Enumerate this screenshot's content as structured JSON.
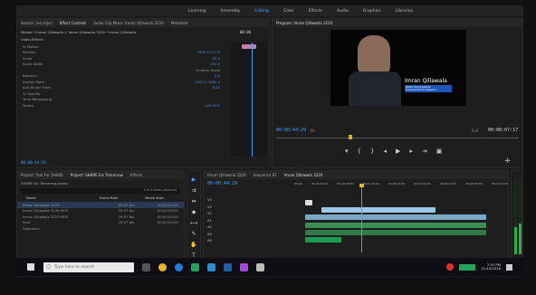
{
  "workspace_tabs": [
    "Learning",
    "Assembly",
    "Editing",
    "Color",
    "Effects",
    "Audio",
    "Graphics",
    "Libraries"
  ],
  "source_panel": {
    "tabs": [
      "Source: (no clips)",
      "Effect Controls",
      "Audio Clip Mixer: Imran Qillawala 3220",
      "Metadata"
    ],
    "clip_path": "Master * Imran Qillawala  >  Imran Qillawala 3220 * Imran Qillawala",
    "section": "Video Effects",
    "rows": [
      {
        "label": "fx  Motion",
        "value": ""
      },
      {
        "label": "Position",
        "value": "1920.0   571.0"
      },
      {
        "label": "Scale",
        "value": "93.0"
      },
      {
        "label": "Scale Width",
        "value": "100.0"
      },
      {
        "label": "",
        "value": "Uniform Scale"
      },
      {
        "label": "Rotation",
        "value": "0.0"
      },
      {
        "label": "Anchor Point",
        "value": "1920.0   1080.0"
      },
      {
        "label": "Anti-flicker Filter",
        "value": "0.00"
      },
      {
        "label": "fx  Opacity",
        "value": ""
      },
      {
        "label": "Time Remapping",
        "value": ""
      },
      {
        "label": "Speed",
        "value": "100.00%"
      }
    ],
    "timecode_head": "00:00",
    "timecode": "00:00:44:29"
  },
  "program": {
    "title": "Program: Imran Qillawala 3220",
    "name": "Imran Qillawala",
    "subtitle1": "Global Vice President",
    "subtitle2": "Divisional Home Inspector",
    "timecode": "00:00:44:29",
    "fit": "Fit",
    "res": "Full",
    "duration": "00:08:07:17"
  },
  "project": {
    "tabs": [
      "Project: Text For SHARE",
      "Project: SHARE For Tomorrow",
      "Effects"
    ],
    "file": "SHARE For Tomorrow.prproj",
    "selection": "1 of 4 items selected",
    "cols": [
      "Name",
      "Frame Rate",
      "Media Start"
    ],
    "items": [
      {
        "name": "Imran Qillawala 3220",
        "rate": "29.97 fps",
        "start": "00;00;00;00"
      },
      {
        "name": "Imran Qillawala 3249.MOV",
        "rate": "29.97 fps",
        "start": "00;00;00;00"
      },
      {
        "name": "Imran Qillawala 3323.MOV",
        "rate": "29.97 fps",
        "start": "00;00;00;00"
      },
      {
        "name": "Sara",
        "rate": "29.97 fps",
        "start": "00;00;00;00"
      },
      {
        "name": "Sequence",
        "rate": "",
        "start": ""
      }
    ]
  },
  "timeline": {
    "tabs": [
      "Imran Qillawala 3220",
      "Sequence 01",
      "Imran Qillawala 3220"
    ],
    "timecode": "00:00:44:29",
    "ruler": [
      "00;00",
      "00;00;04;00",
      "00;00;08;00",
      "00;00;12;00",
      "00;00;16;00",
      "00;00;20;00",
      "00;00;24;00",
      "00;00;28;00",
      "00;00;32;00"
    ],
    "tracks": [
      "V3",
      "V2",
      "V1",
      "A1",
      "A2",
      "A3",
      "A4"
    ]
  },
  "taskbar": {
    "search_placeholder": "Type here to search",
    "time": "7:55 PM",
    "date": "11/15/2018"
  }
}
